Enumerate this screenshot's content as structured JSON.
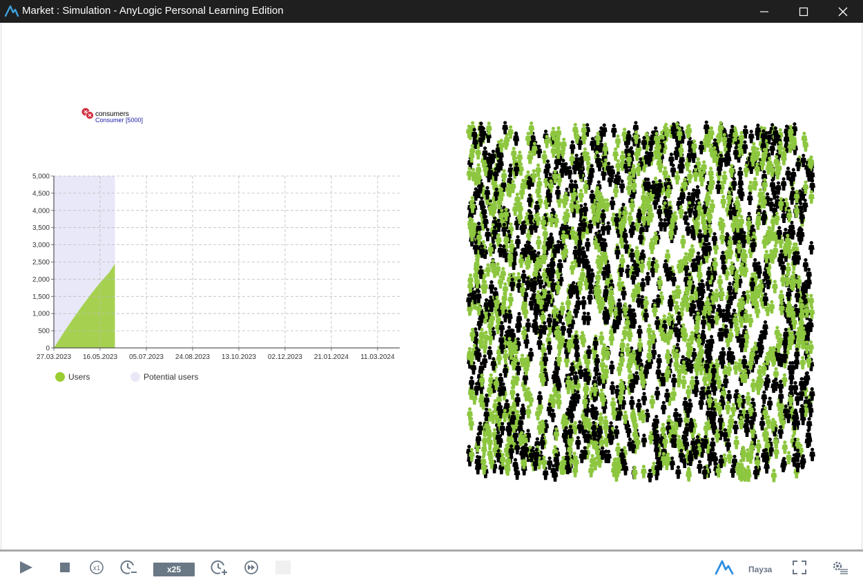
{
  "window": {
    "title": "Market : Simulation - AnyLogic Personal Learning Edition",
    "icon": "anylogic-logo-icon",
    "controls": [
      "minimize-icon",
      "maximize-icon",
      "close-icon"
    ]
  },
  "agent_population": {
    "name": "consumers",
    "type_label": "Consumer [5000]",
    "icon": "agent-population-icon",
    "icon_color": "#d32f3f"
  },
  "chart_data": {
    "type": "area",
    "y_ticks": [
      "0",
      "500",
      "1,000",
      "1,500",
      "2,000",
      "2,500",
      "3,000",
      "3,500",
      "4,000",
      "4,500",
      "5,000"
    ],
    "ylim": [
      0,
      5000
    ],
    "x_ticks": [
      "27.03.2023",
      "16.05.2023",
      "05.07.2023",
      "24.08.2023",
      "13.10.2023",
      "02.12.2023",
      "21.01.2024",
      "11.03.2024"
    ],
    "x_start": "27.03.2023",
    "grid": true,
    "legend_position": "bottom",
    "series": [
      {
        "name": "Users",
        "color": "#9acd32",
        "x": [
          "27.03.2023",
          "06.04.2023",
          "16.04.2023",
          "26.04.2023",
          "06.05.2023",
          "16.05.2023",
          "26.05.2023",
          "01.06.2023"
        ],
        "values": [
          0,
          420,
          820,
          1200,
          1560,
          1900,
          2200,
          2450
        ]
      },
      {
        "name": "Potential users",
        "color": "#e8e8f8",
        "x": [
          "27.03.2023",
          "06.04.2023",
          "16.04.2023",
          "26.04.2023",
          "06.05.2023",
          "16.05.2023",
          "26.05.2023",
          "01.06.2023"
        ],
        "values": [
          5000,
          5000,
          5000,
          5000,
          5000,
          5000,
          5000,
          5000
        ]
      }
    ]
  },
  "legend": [
    {
      "label": "Users",
      "color": "#9acd32"
    },
    {
      "label": "Potential users",
      "color": "#e8e8f8"
    }
  ],
  "crowd": {
    "colors": {
      "user": "#8dc63f",
      "potential": "#000000"
    }
  },
  "toolbar": {
    "speed_label": "x25",
    "pause_label": "Пауза",
    "icons": [
      "run-icon",
      "stop-icon",
      "realtime-x1-icon",
      "slow-down-icon",
      "speed-up-icon",
      "virtual-time-icon",
      "anylogic-logo-icon",
      "fullscreen-icon",
      "settings-icon"
    ],
    "accent": "#6a7785"
  }
}
